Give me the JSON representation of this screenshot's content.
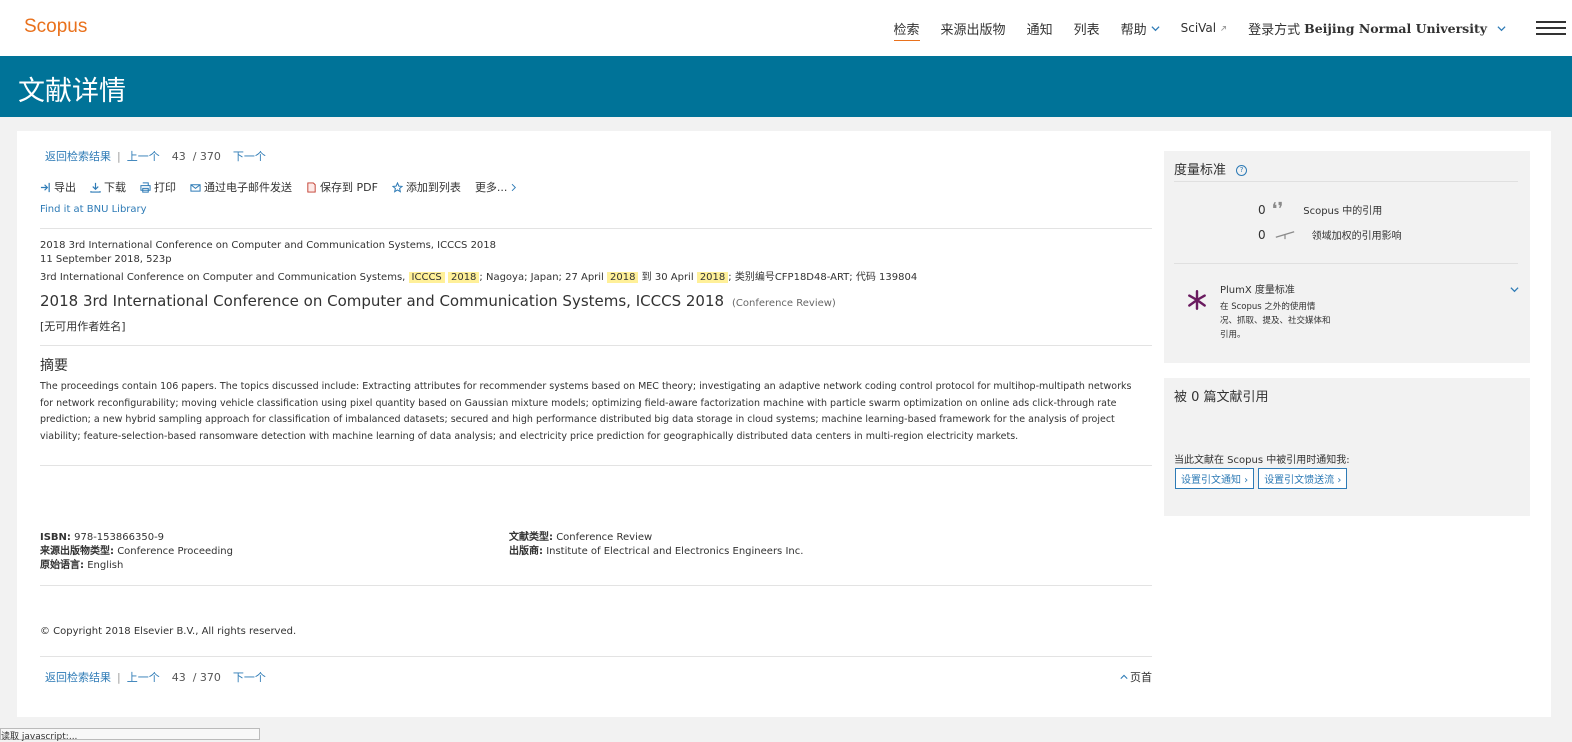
{
  "header": {
    "logo": "Scopus",
    "nav": [
      "检索",
      "来源出版物",
      "通知",
      "列表"
    ],
    "help": "帮助",
    "scival": "SciVal",
    "login_prefix": "登录方式",
    "institution": "Beijing Normal University"
  },
  "page_title": "文献详情",
  "pager": {
    "back": "返回检索结果",
    "prev": "上一个",
    "current": "43",
    "total": "/ 370",
    "next": "下一个"
  },
  "toolbar": {
    "export": "导出",
    "download": "下载",
    "print": "打印",
    "email": "通过电子邮件发送",
    "pdf": "保存到 PDF",
    "add_list": "添加到列表",
    "more": "更多..."
  },
  "find_it": "Find it at BNU Library",
  "source": {
    "line1": "2018 3rd International Conference on Computer and Communication Systems, ICCCS 2018",
    "line2": "11 September 2018, 523p",
    "line3_a": "3rd International Conference on Computer and Communication Systems,",
    "hl1": "ICCCS",
    "hl2": "2018",
    "line3_b": "; Nagoya; Japan; 27 April",
    "hl3": "2018",
    "line3_c": "到 30 April",
    "hl4": "2018",
    "line3_d": "; 类别编号CFP18D48-ART; 代码 139804"
  },
  "doc": {
    "title": "2018 3rd International Conference on Computer and Communication Systems, ICCCS 2018",
    "type": "(Conference Review)",
    "authors": "[无可用作者姓名]"
  },
  "abstract": {
    "heading": "摘要",
    "text": "The proceedings contain 106 papers. The topics discussed include: Extracting attributes for recommender systems based on MEC theory; investigating an adaptive network coding control protocol for multihop-multipath networks for network reconfigurability; moving vehicle classification using pixel quantity based on Gaussian mixture models; optimizing field-aware factorization machine with particle swarm optimization on online ads click-through rate prediction; a new hybrid sampling approach for classification of imbalanced datasets; secured and high performance distributed big data storage in cloud systems; machine learning-based framework for the analysis of project viability; feature-selection-based ransomware detection with machine learning of data analysis; and electricity price prediction for geographically distributed data centers in multi-region electricity markets."
  },
  "meta": {
    "isbn_label": "ISBN:",
    "isbn": "978-153866350-9",
    "srctype_label": "来源出版物类型:",
    "srctype": "Conference Proceeding",
    "lang_label": "原始语言:",
    "lang": "English",
    "doctype_label": "文献类型:",
    "doctype": "Conference Review",
    "publisher_label": "出版商:",
    "publisher": "Institute of Electrical and Electronics Engineers Inc."
  },
  "copyright": "© Copyright 2018 Elsevier B.V., All rights reserved.",
  "top_link": "页首",
  "metrics": {
    "heading": "度量标准",
    "cite_count": "0",
    "cite_label": "Scopus 中的引用",
    "fwci": "0",
    "fwci_label": "领域加权的引用影响",
    "plumx_title": "PlumX 度量标准",
    "plumx_desc": "在 Scopus 之外的使用情况、抓取、提及、社交媒体和引用。"
  },
  "cited_by": {
    "heading": "被 0 篇文献引用",
    "notify": "当此文献在 Scopus 中被引用时通知我:",
    "btn_alert": "设置引文通知",
    "btn_feed": "设置引文馈送流"
  },
  "status_bar": "读取 javascript:..."
}
